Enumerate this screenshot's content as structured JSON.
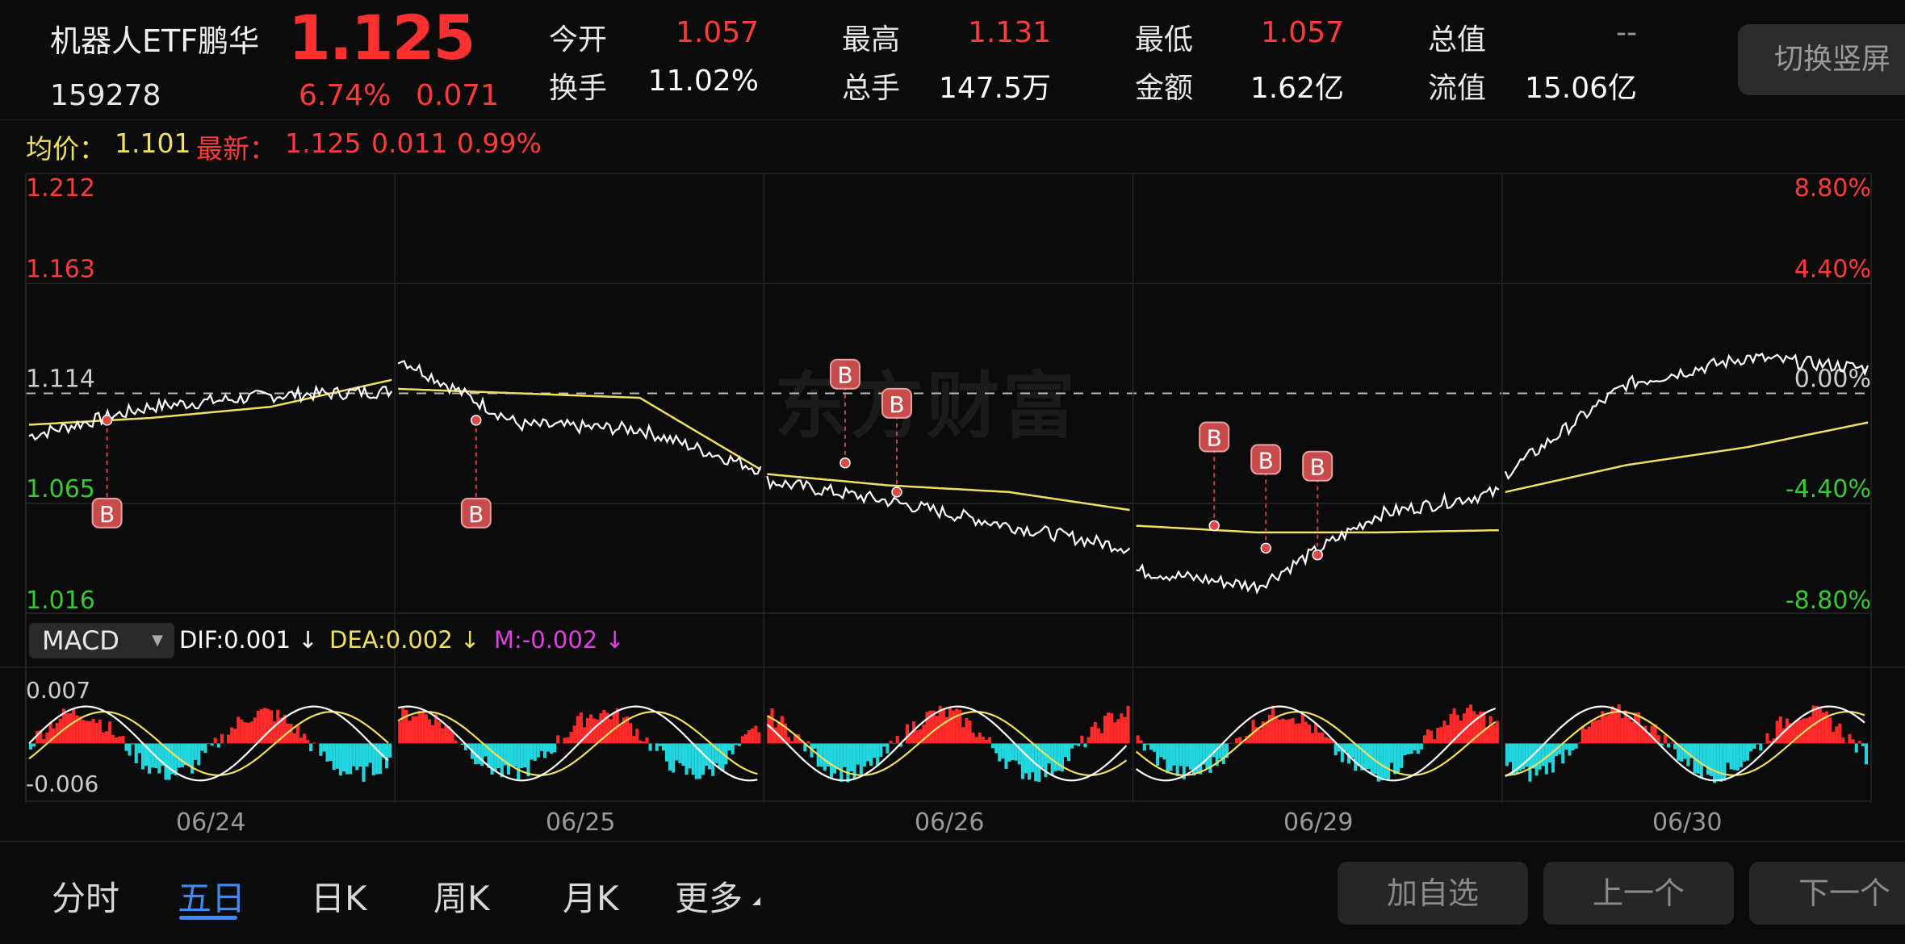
{
  "header": {
    "name": "机器人ETF鹏华",
    "price": "1.125",
    "code": "159278",
    "change_pct": "6.74%",
    "change": "0.071",
    "stats": [
      {
        "label": "今开",
        "value": "1.057",
        "color": "red"
      },
      {
        "label": "换手",
        "value": "11.02%",
        "color": "white"
      },
      {
        "label": "最高",
        "value": "1.131",
        "color": "red"
      },
      {
        "label": "总手",
        "value": "147.5万",
        "color": "white"
      },
      {
        "label": "最低",
        "value": "1.057",
        "color": "red"
      },
      {
        "label": "金额",
        "value": "1.62亿",
        "color": "white"
      },
      {
        "label": "总值",
        "value": "--",
        "color": "dim"
      },
      {
        "label": "流值",
        "value": "15.06亿",
        "color": "white"
      }
    ],
    "switch_button": "切换竖屏"
  },
  "avg_row": {
    "avg_label": "均价：",
    "avg_value": "1.101",
    "latest_label": "最新：",
    "latest_value": "1.125",
    "latest_change": "0.011",
    "latest_pct": "0.99%"
  },
  "chart": {
    "watermark": "东方财富",
    "y_left": [
      "1.212",
      "1.163",
      "1.114",
      "1.065",
      "1.016"
    ],
    "y_right": [
      "8.80%",
      "4.40%",
      "0.00%",
      "-4.40%",
      "-8.80%"
    ],
    "marker_label": "B",
    "dates": [
      "06/24",
      "06/25",
      "06/26",
      "06/29",
      "06/30"
    ]
  },
  "macd": {
    "indicator": "MACD",
    "dif": "DIF:0.001 ↓",
    "dea": "DEA:0.002 ↓",
    "m": "M:-0.002 ↓",
    "y_top": "0.007",
    "y_bottom": "-0.006"
  },
  "tabs": [
    "分时",
    "五日",
    "日K",
    "周K",
    "月K",
    "更多"
  ],
  "active_tab": "五日",
  "buttons": {
    "add_watch": "加自选",
    "prev": "上一个",
    "next": "下一个"
  },
  "colors": {
    "up": "#ff3b3b",
    "down": "#38c838",
    "price_line": "#ffffff",
    "avg_line": "#f0e060",
    "macd_pos": "#ff2a2a",
    "macd_neg": "#22d6e0",
    "accent": "#3d8bf0"
  },
  "chart_data": {
    "type": "line",
    "title": "",
    "x": [
      "06/24",
      "06/25",
      "06/26",
      "06/29",
      "06/30"
    ],
    "ylim": [
      1.016,
      1.212
    ],
    "ylabel": "",
    "reference_price": 1.114,
    "series": [
      {
        "values": [
          1.095,
          1.108,
          1.113,
          1.115,
          1.13,
          1.1,
          1.098,
          1.08,
          1.075,
          1.066,
          1.055,
          1.045,
          1.035,
          1.028,
          1.06,
          1.07,
          1.078,
          1.118,
          1.13,
          1.125
        ]
      },
      {
        "values": [
          1.1,
          1.103,
          1.108,
          1.12,
          1.116,
          1.114,
          1.112,
          1.08,
          1.078,
          1.073,
          1.07,
          1.062,
          1.055,
          1.052,
          1.052,
          1.053,
          1.07,
          1.082,
          1.09,
          1.101
        ]
      }
    ],
    "buy_markers": [
      {
        "day": "06/24",
        "price": 1.102
      },
      {
        "day": "06/25",
        "price": 1.102
      },
      {
        "day": "06/26",
        "price": 1.083
      },
      {
        "day": "06/26",
        "price": 1.07
      },
      {
        "day": "06/29",
        "price": 1.055
      },
      {
        "day": "06/29",
        "price": 1.045
      },
      {
        "day": "06/29",
        "price": 1.042
      }
    ],
    "macd": {
      "ylim": [
        -0.006,
        0.007
      ]
    }
  }
}
